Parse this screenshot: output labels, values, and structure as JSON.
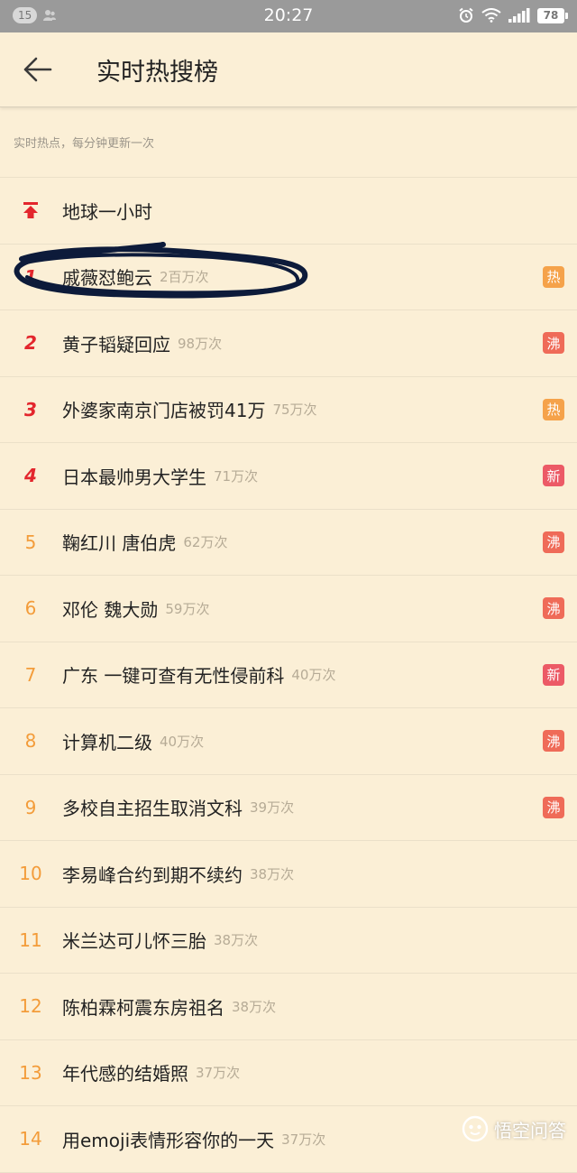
{
  "status_bar": {
    "notification_count": "15",
    "time": "20:27",
    "battery": "78",
    "icons": [
      "person-icon",
      "alarm-icon",
      "wifi-icon",
      "signal-icon",
      "battery-icon"
    ]
  },
  "header": {
    "back_icon": "arrow-left-icon",
    "title": "实时热搜榜"
  },
  "subtitle": "实时热点，每分钟更新一次",
  "colors": {
    "background": "#fbefd6",
    "rank_top": "#e3262d",
    "rank_mid": "#f39c3a",
    "tag_hot": "#f5a24a",
    "tag_boil": "#ef6b58",
    "tag_new": "#ec5a66"
  },
  "items": [
    {
      "rank": "",
      "keyword": "地球一小时",
      "count": "",
      "tag": ""
    },
    {
      "rank": "1",
      "keyword": "戚薇怼鲍云",
      "count": "2百万次",
      "tag": "热"
    },
    {
      "rank": "2",
      "keyword": "黄子韬疑回应",
      "count": "98万次",
      "tag": "沸"
    },
    {
      "rank": "3",
      "keyword": "外婆家南京门店被罚41万",
      "count": "75万次",
      "tag": "热"
    },
    {
      "rank": "4",
      "keyword": "日本最帅男大学生",
      "count": "71万次",
      "tag": "新"
    },
    {
      "rank": "5",
      "keyword": "鞠红川 唐伯虎",
      "count": "62万次",
      "tag": "沸"
    },
    {
      "rank": "6",
      "keyword": "邓伦 魏大勋",
      "count": "59万次",
      "tag": "沸"
    },
    {
      "rank": "7",
      "keyword": "广东 一键可查有无性侵前科",
      "count": "40万次",
      "tag": "新"
    },
    {
      "rank": "8",
      "keyword": "计算机二级",
      "count": "40万次",
      "tag": "沸"
    },
    {
      "rank": "9",
      "keyword": "多校自主招生取消文科",
      "count": "39万次",
      "tag": "沸"
    },
    {
      "rank": "10",
      "keyword": "李易峰合约到期不续约",
      "count": "38万次",
      "tag": ""
    },
    {
      "rank": "11",
      "keyword": "米兰达可儿怀三胎",
      "count": "38万次",
      "tag": ""
    },
    {
      "rank": "12",
      "keyword": "陈柏霖柯震东房祖名",
      "count": "38万次",
      "tag": ""
    },
    {
      "rank": "13",
      "keyword": "年代感的结婚照",
      "count": "37万次",
      "tag": ""
    },
    {
      "rank": "14",
      "keyword": "用emoji表情形容你的一天",
      "count": "37万次",
      "tag": ""
    }
  ],
  "watermark": "悟空问答"
}
